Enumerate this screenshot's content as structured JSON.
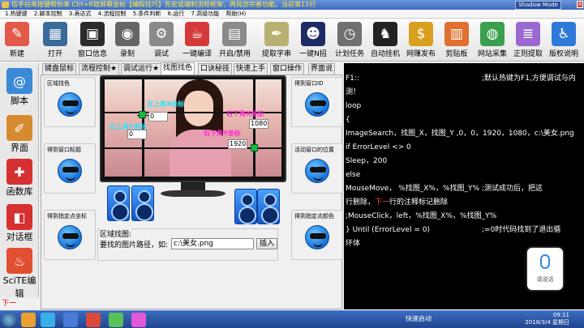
{
  "window": {
    "title": "信手拈来按键帮你来 Ctrl+R取屏幕坐标【编程技巧】先宏或编制流程框架，再局部完善功能。当前第11行",
    "shadow_mode": "Shadow Mode",
    "controls": [
      "_",
      "□",
      "×"
    ]
  },
  "menu": [
    "1.热键键",
    "2.脚本控制",
    "3.表达式",
    "4.流程控制",
    "5.条件判断",
    "6.运行",
    "7.高级功能",
    "帮助(H)"
  ],
  "toolbar": [
    {
      "label": "新建",
      "icon": "new-icon",
      "color": "#e25a4a",
      "glyph": "✎"
    },
    {
      "label": "打开",
      "icon": "open-book-icon",
      "color": "#3a6a9a",
      "glyph": "▦"
    },
    {
      "label": "窗口信息",
      "icon": "window-info-icon",
      "color": "#2b2b2b",
      "glyph": "▣"
    },
    {
      "label": "录制",
      "icon": "webcam-icon",
      "color": "#666666",
      "glyph": "◉"
    },
    {
      "label": "调试",
      "icon": "gears-icon",
      "color": "#8a8a8a",
      "glyph": "⚙"
    },
    {
      "label": "一键编译",
      "icon": "compile-cup-icon",
      "color": "#d53a3a",
      "glyph": "☕"
    },
    {
      "label": "开启/禁用",
      "icon": "toggle-panel-icon",
      "color": "#8a8a8a",
      "glyph": "▤"
    },
    {
      "label": "提取字串",
      "icon": "pen-icon",
      "color": "#b8b070",
      "glyph": "✒"
    },
    {
      "label": "一键N招",
      "icon": "helmet-icon",
      "color": "#1e2a66",
      "glyph": "☻"
    },
    {
      "label": "计划任务",
      "icon": "clock-icon",
      "color": "#707070",
      "glyph": "◷"
    },
    {
      "label": "自动挂机",
      "icon": "panda-icon",
      "color": "#222222",
      "glyph": "♞"
    },
    {
      "label": "网赚发布",
      "icon": "money-icon",
      "color": "#d9a020",
      "glyph": "$"
    },
    {
      "label": "剪贴板",
      "icon": "clipboard-icon",
      "color": "#e07030",
      "glyph": "▥"
    },
    {
      "label": "网站采集",
      "icon": "globe-mouse-icon",
      "color": "#3aa050",
      "glyph": "◍"
    },
    {
      "label": "正则提取",
      "icon": "regex-list-icon",
      "color": "#9a6ad0",
      "glyph": "≣"
    },
    {
      "label": "版权说明",
      "icon": "accessibility-icon",
      "color": "#2f79d8",
      "glyph": "♿"
    }
  ],
  "left_bar": {
    "items": [
      {
        "label": "脚本",
        "icon": "script-icon",
        "color": "#3a8ad8",
        "glyph": "@"
      },
      {
        "label": "界面",
        "icon": "ui-tools-icon",
        "color": "#d88a30",
        "glyph": "✐"
      },
      {
        "label": "函数库",
        "icon": "gift-box-icon",
        "color": "#d63030",
        "glyph": "✚"
      },
      {
        "label": "对话框",
        "icon": "dialog-icon",
        "color": "#d63030",
        "glyph": "◧"
      },
      {
        "label": "SciTE编辑",
        "icon": "popcorn-icon",
        "color": "#e05030",
        "glyph": "♨"
      }
    ],
    "bottom_text": "下一"
  },
  "tabs": [
    {
      "label": "键盘鼠标",
      "active": false
    },
    {
      "label": "流程控制★",
      "active": false
    },
    {
      "label": "调试运行★",
      "active": false
    },
    {
      "label": "找图找色",
      "active": true
    },
    {
      "label": "口诀秘技",
      "active": false
    },
    {
      "label": "快速上手",
      "active": false
    },
    {
      "label": "窗口操作",
      "active": false
    },
    {
      "label": "界面说",
      "active": false
    }
  ],
  "panel": {
    "groups": [
      {
        "caption": "区域找色"
      },
      {
        "caption": "得到窗口标题"
      },
      {
        "caption": "得到指定点坐标"
      },
      {
        "caption": "得到窗口ID"
      },
      {
        "caption": "活动窗口的位置"
      },
      {
        "caption": "得到指定点颜色"
      }
    ],
    "monitor": {
      "label_topleft_x": "左上角X坐标",
      "label_topleft_y": "左上角Y坐标",
      "label_bottomright_x": "右下角X坐标",
      "label_bottomright_y": "右下角Y坐标",
      "value_topleft_x": "0",
      "value_topleft_y": "0",
      "value_bottomright_x": "1920",
      "value_bottomright_y": "1080"
    },
    "find_image": {
      "caption": "区域找图:",
      "label": "要找的图片路径，如:",
      "value": "c:\\美女.png",
      "insert_button": "插入"
    }
  },
  "code": {
    "lines": [
      {
        "text": "F1::",
        "comment": ";默认热键为F1,方便调试与内"
      },
      {
        "text": "测！"
      },
      {
        "text": "loop"
      },
      {
        "text": "{"
      },
      {
        "text": "ImageSearch，找图_X，找图_Y ,0，0，1920，1080，c:\\美女.png"
      },
      {
        "text": "if ErrorLevel   <> 0"
      },
      {
        "text": "Sleep，200"
      },
      {
        "text": "else"
      },
      {
        "text": "MouseMove，  %找图_X%，%找图_Y%",
        "comment": ";测试成功后，把这"
      },
      {
        "text": "行删除，",
        "red": "下一",
        "rest": "行的注释标记删除"
      },
      {
        "text": ";MouseClick，left，%找图_X%，%找图_Y%"
      },
      {
        "text": "} Until  (ErrorLevel   = 0)",
        "comment": ";=0时代码找到了退出循"
      },
      {
        "text": "环体"
      }
    ]
  },
  "voice": {
    "label": "请说话"
  },
  "taskbar": {
    "tray_text": "快速启动",
    "time": "09:11",
    "date": "2018/3/4 星期日"
  }
}
